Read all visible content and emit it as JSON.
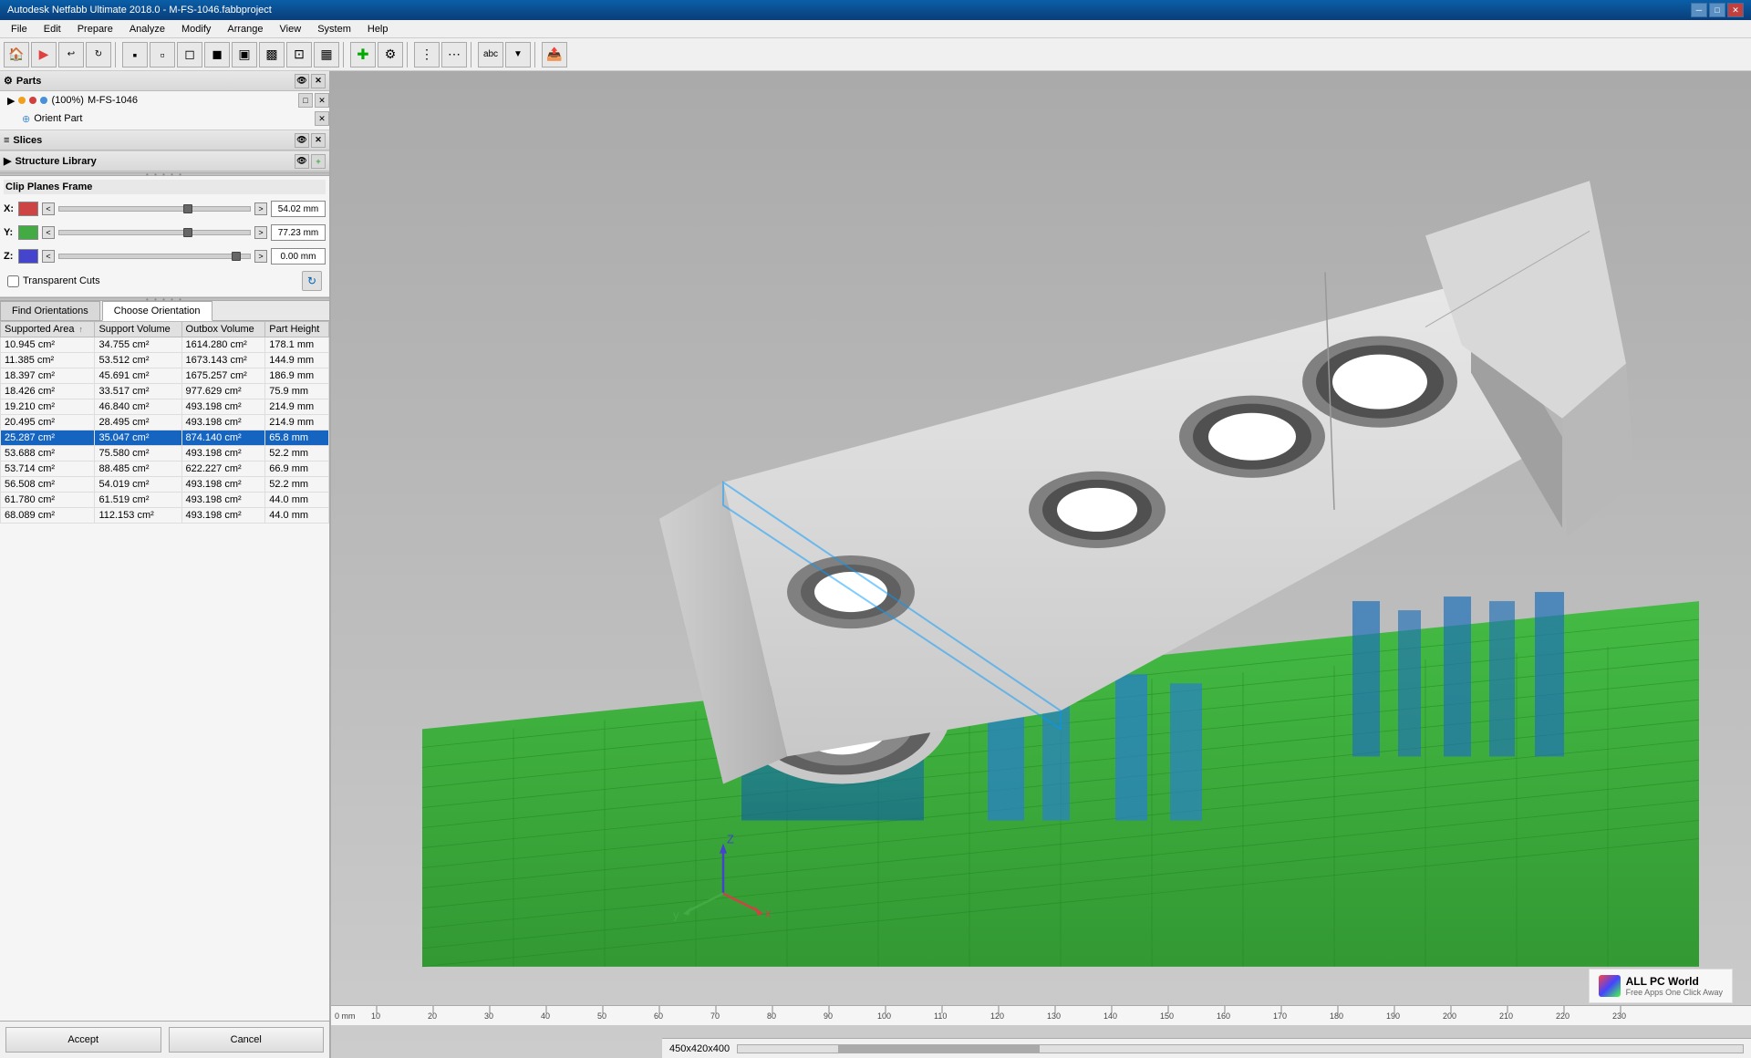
{
  "title_bar": {
    "title": "Autodesk Netfabb Ultimate 2018.0 - M-FS-1046.fabbproject",
    "minimize": "─",
    "maximize": "□",
    "close": "✕"
  },
  "menu": {
    "items": [
      "File",
      "Edit",
      "Prepare",
      "Analyze",
      "Modify",
      "Arrange",
      "View",
      "System",
      "Help"
    ]
  },
  "left_panel": {
    "parts": {
      "label": "Parts",
      "item": {
        "percent": "(100%)",
        "name": "M-FS-1046",
        "sub": "Orient Part"
      }
    },
    "slices": {
      "label": "Slices"
    },
    "structure_library": {
      "label": "Structure Library"
    }
  },
  "clip_planes": {
    "title": "Clip Planes Frame",
    "axes": [
      {
        "label": "X",
        "color": "#cc4444",
        "value": "54.02 mm"
      },
      {
        "label": "Y",
        "color": "#44aa44",
        "value": "77.23 mm"
      },
      {
        "label": "Z",
        "color": "#4444cc",
        "value": "0.00 mm"
      }
    ],
    "transparent_cuts": "Transparent Cuts"
  },
  "orientations": {
    "tab_find": "Find Orientations",
    "tab_choose": "Choose Orientation",
    "table": {
      "headers": [
        "Supported Area ↑",
        "Support Volume",
        "Outbox Volume",
        "Part Height"
      ],
      "rows": [
        {
          "supported_area": "10.945 cm²",
          "support_volume": "34.755 cm²",
          "outbox_volume": "1614.280 cm²",
          "part_height": "178.1 mm",
          "selected": false,
          "highlight": false
        },
        {
          "supported_area": "11.385 cm²",
          "support_volume": "53.512 cm²",
          "outbox_volume": "1673.143 cm²",
          "part_height": "144.9 mm",
          "selected": false,
          "highlight": false
        },
        {
          "supported_area": "18.397 cm²",
          "support_volume": "45.691 cm²",
          "outbox_volume": "1675.257 cm²",
          "part_height": "186.9 mm",
          "selected": false,
          "highlight": false
        },
        {
          "supported_area": "18.426 cm²",
          "support_volume": "33.517 cm²",
          "outbox_volume": "977.629 cm²",
          "part_height": "75.9 mm",
          "selected": false,
          "highlight": false
        },
        {
          "supported_area": "19.210 cm²",
          "support_volume": "46.840 cm²",
          "outbox_volume": "493.198 cm²",
          "part_height": "214.9 mm",
          "selected": false,
          "highlight": false
        },
        {
          "supported_area": "20.495 cm²",
          "support_volume": "28.495 cm²",
          "outbox_volume": "493.198 cm²",
          "part_height": "214.9 mm",
          "selected": false,
          "highlight": false
        },
        {
          "supported_area": "25.287 cm²",
          "support_volume": "35.047 cm²",
          "outbox_volume": "874.140 cm²",
          "part_height": "65.8 mm",
          "selected": true,
          "highlight": false
        },
        {
          "supported_area": "53.688 cm²",
          "support_volume": "75.580 cm²",
          "outbox_volume": "493.198 cm²",
          "part_height": "52.2 mm",
          "selected": false,
          "highlight": false
        },
        {
          "supported_area": "53.714 cm²",
          "support_volume": "88.485 cm²",
          "outbox_volume": "622.227 cm²",
          "part_height": "66.9 mm",
          "selected": false,
          "highlight": false
        },
        {
          "supported_area": "56.508 cm²",
          "support_volume": "54.019 cm²",
          "outbox_volume": "493.198 cm²",
          "part_height": "52.2 mm",
          "selected": false,
          "highlight": false
        },
        {
          "supported_area": "61.780 cm²",
          "support_volume": "61.519 cm²",
          "outbox_volume": "493.198 cm²",
          "part_height": "44.0 mm",
          "selected": false,
          "highlight": false
        },
        {
          "supported_area": "68.089 cm²",
          "support_volume": "112.153 cm²",
          "outbox_volume": "493.198 cm²",
          "part_height": "44.0 mm",
          "selected": false,
          "highlight": false
        }
      ]
    }
  },
  "buttons": {
    "accept": "Accept",
    "cancel": "Cancel"
  },
  "status_bar": {
    "dimensions": "450x420x400"
  },
  "watermark": {
    "site": "ALL PC World",
    "sub": "Free Apps One Click Away"
  },
  "ruler": {
    "marks": [
      "0 mm",
      "10",
      "20",
      "30",
      "40",
      "50",
      "60",
      "70",
      "80",
      "90",
      "100",
      "110",
      "120",
      "130",
      "140",
      "150",
      "160",
      "170",
      "180",
      "190",
      "200",
      "210",
      "220",
      "230"
    ]
  }
}
